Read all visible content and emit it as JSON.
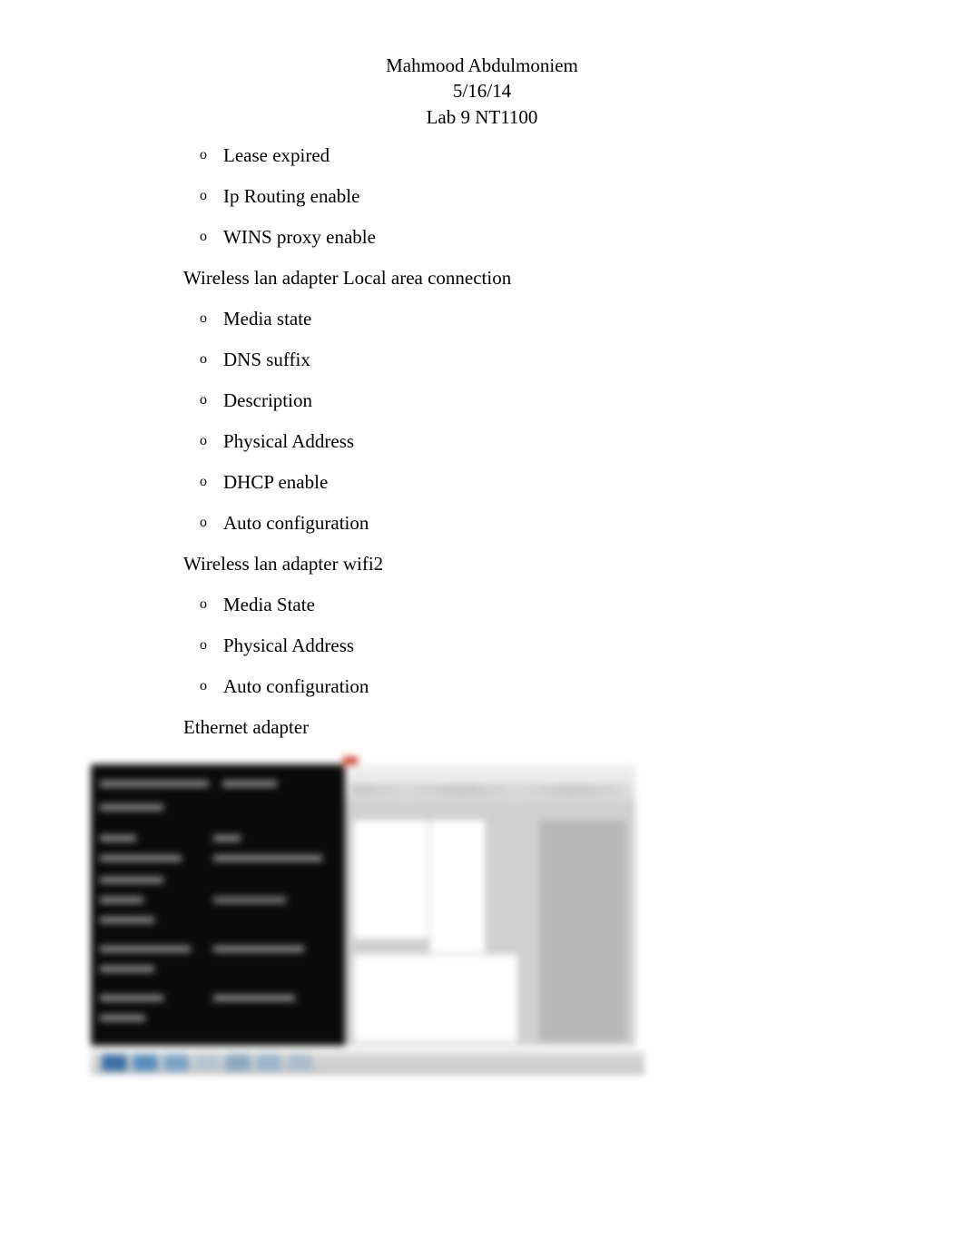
{
  "header": {
    "name": "Mahmood Abdulmoniem",
    "date": "5/16/14",
    "lab": "Lab 9 NT1100"
  },
  "topItems": [
    "Lease expired",
    "Ip Routing enable",
    "WINS proxy enable"
  ],
  "sections": [
    {
      "title": "Wireless lan adapter Local area connection",
      "items": [
        "Media state",
        "DNS suffix",
        "Description",
        "Physical Address",
        "DHCP enable",
        "Auto configuration"
      ]
    },
    {
      "title": "Wireless lan adapter wifi2",
      "items": [
        "Media State",
        "Physical Address",
        "Auto configuration"
      ]
    },
    {
      "title": "Ethernet adapter",
      "items": []
    }
  ],
  "markers": {
    "sub": "o",
    "bullet": ""
  }
}
